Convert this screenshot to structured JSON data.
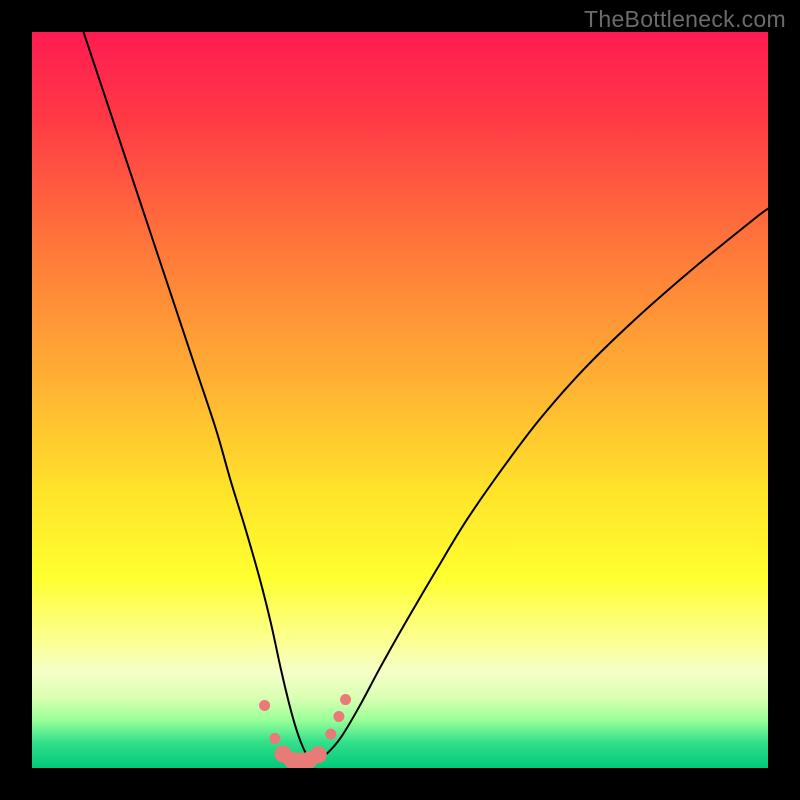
{
  "watermark": "TheBottleneck.com",
  "chart_data": {
    "type": "line",
    "title": "",
    "xlabel": "",
    "ylabel": "",
    "xlim": [
      0,
      100
    ],
    "ylim": [
      0,
      100
    ],
    "gradient_stops": [
      {
        "offset": 0.0,
        "color": "#ff1b52"
      },
      {
        "offset": 0.12,
        "color": "#ff3a45"
      },
      {
        "offset": 0.3,
        "color": "#ff7a3a"
      },
      {
        "offset": 0.48,
        "color": "#ffb233"
      },
      {
        "offset": 0.62,
        "color": "#ffe22a"
      },
      {
        "offset": 0.74,
        "color": "#ffff2e"
      },
      {
        "offset": 0.82,
        "color": "#fcff8a"
      },
      {
        "offset": 0.87,
        "color": "#f5ffc8"
      },
      {
        "offset": 0.905,
        "color": "#d9ffb2"
      },
      {
        "offset": 0.935,
        "color": "#99ff99"
      },
      {
        "offset": 0.965,
        "color": "#33e08a"
      },
      {
        "offset": 1.0,
        "color": "#00c97a"
      }
    ],
    "series": [
      {
        "name": "bottleneck-curve",
        "x": [
          7,
          10,
          13,
          16,
          19,
          22,
          25,
          27,
          29,
          31,
          32.5,
          33.8,
          35,
          36,
          37,
          37.8,
          38.5,
          40,
          42,
          44.5,
          47.5,
          51,
          55,
          59,
          64,
          69,
          75,
          82,
          90,
          98,
          100
        ],
        "y": [
          100,
          91,
          82,
          73,
          64,
          55,
          46,
          39,
          32.5,
          25.5,
          19.5,
          13.5,
          8.5,
          5.0,
          2.4,
          1.2,
          1.15,
          1.9,
          4.2,
          8.4,
          14,
          20.2,
          27,
          33.6,
          40.8,
          47.4,
          54.2,
          61,
          68,
          74.5,
          76
        ]
      }
    ],
    "markers": {
      "name": "highlight-dots",
      "color": "#e87b78",
      "radius_small": 5.5,
      "radius_large": 8.5,
      "points": [
        {
          "x": 31.6,
          "y": 8.5,
          "r": "small"
        },
        {
          "x": 33.0,
          "y": 4.0,
          "r": "small"
        },
        {
          "x": 34.1,
          "y": 1.9,
          "r": "large"
        },
        {
          "x": 35.3,
          "y": 1.05,
          "r": "large"
        },
        {
          "x": 36.5,
          "y": 0.95,
          "r": "large"
        },
        {
          "x": 37.7,
          "y": 1.1,
          "r": "large"
        },
        {
          "x": 38.9,
          "y": 1.8,
          "r": "large"
        },
        {
          "x": 40.6,
          "y": 4.6,
          "r": "small"
        },
        {
          "x": 41.7,
          "y": 7.0,
          "r": "small"
        },
        {
          "x": 42.6,
          "y": 9.3,
          "r": "small"
        }
      ]
    }
  }
}
